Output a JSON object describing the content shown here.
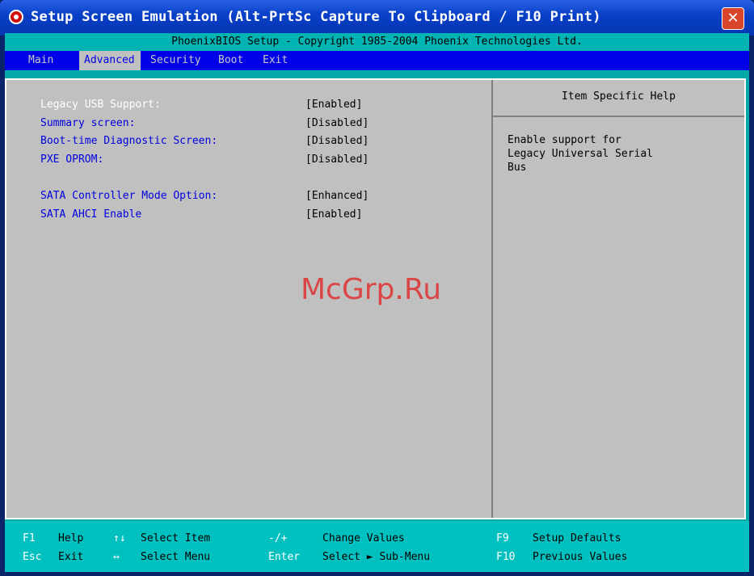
{
  "window": {
    "title": "Setup Screen Emulation (Alt-PrtSc Capture To Clipboard / F10 Print)",
    "close_label": "✕"
  },
  "bios": {
    "copyright": "PhoenixBIOS Setup - Copyright 1985-2004 Phoenix Technologies Ltd.",
    "menu": [
      {
        "label": "Main"
      },
      {
        "label": "Advanced"
      },
      {
        "label": "Security"
      },
      {
        "label": "Boot"
      },
      {
        "label": "Exit"
      }
    ],
    "active_menu": "Advanced",
    "settings": [
      {
        "label": "Legacy USB Support:",
        "value": "[Enabled]"
      },
      {
        "label": "Summary screen:",
        "value": "[Disabled]"
      },
      {
        "label": "Boot-time Diagnostic Screen:",
        "value": "[Disabled]"
      },
      {
        "label": "PXE OPROM:",
        "value": "[Disabled]"
      },
      {
        "label": "SATA Controller Mode Option:",
        "value": "[Enhanced]"
      },
      {
        "label": "SATA AHCI Enable",
        "value": "[Enabled]"
      }
    ],
    "help": {
      "header": "Item Specific Help",
      "text": "Enable support for\nLegacy Universal Serial\nBus"
    },
    "footer": [
      {
        "key": "F1",
        "desc": "Help"
      },
      {
        "key": "Esc",
        "desc": "Exit"
      },
      {
        "key": "↑↓",
        "desc": "Select Item"
      },
      {
        "key": "↔",
        "desc": "Select Menu"
      },
      {
        "key": "-/+",
        "desc": "Change Values"
      },
      {
        "key": "Enter",
        "desc": "Select ► Sub-Menu"
      },
      {
        "key": "F9",
        "desc": "Setup Defaults"
      },
      {
        "key": "F10",
        "desc": "Previous Values"
      }
    ]
  },
  "watermark": "McGrp.Ru",
  "colors": {
    "titlebar": "#0840c8",
    "menubar": "#0000e8",
    "panel": "#c0c0c0",
    "frame": "#00a8a8",
    "label": "#0000e0",
    "selected_label": "#ffffff"
  }
}
